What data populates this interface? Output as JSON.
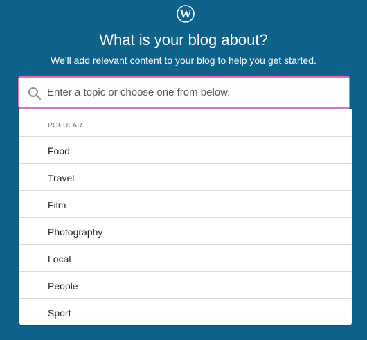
{
  "header": {
    "logo_icon": "wordpress-logo-icon",
    "title": "What is your blog about?",
    "subtitle": "We'll add relevant content to your blog to help you get started."
  },
  "search": {
    "icon": "search-icon",
    "placeholder": "Enter a topic or choose one from below.",
    "value": ""
  },
  "suggestions": {
    "section_label": "POPULAR",
    "items": [
      {
        "label": "Food"
      },
      {
        "label": "Travel"
      },
      {
        "label": "Film"
      },
      {
        "label": "Photography"
      },
      {
        "label": "Local"
      },
      {
        "label": "People"
      },
      {
        "label": "Sport"
      }
    ]
  },
  "colors": {
    "background": "#0e6189",
    "focus_border": "#e26fb7",
    "panel": "#ffffff"
  }
}
